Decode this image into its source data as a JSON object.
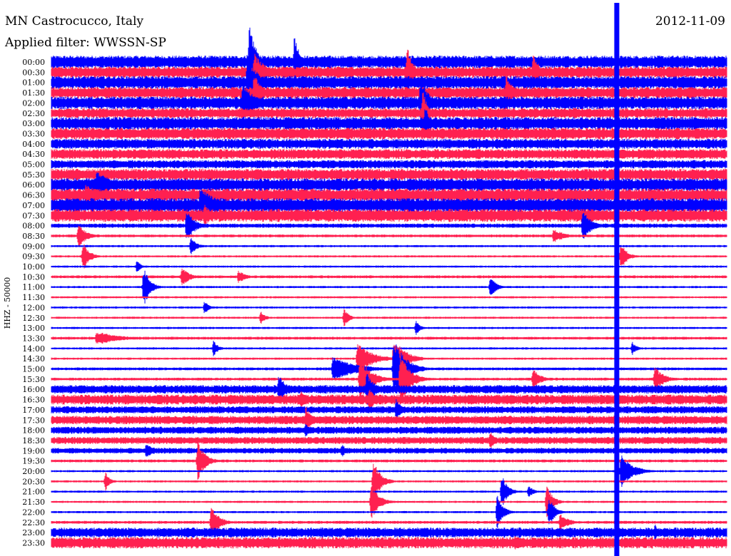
{
  "header": {
    "station": "MN Castrocucco, Italy",
    "filter": "Applied filter: WWSSN-SP",
    "date": "2012-11-09"
  },
  "chart_data": {
    "type": "line",
    "title": "MN Castrocucco, Italy",
    "subtitle": "Applied filter: WWSSN-SP",
    "date": "2012-11-09",
    "ylabel": "HHZ - 50000",
    "colors": {
      "blue": "#0000ff",
      "red": "#ff2050"
    },
    "trace_colors_alternate": [
      "blue",
      "red"
    ],
    "tick_labels": [
      "00:00",
      "00:30",
      "01:00",
      "01:30",
      "02:00",
      "02:30",
      "03:00",
      "03:30",
      "04:00",
      "04:30",
      "05:00",
      "05:30",
      "06:00",
      "06:30",
      "07:00",
      "07:30",
      "08:00",
      "08:30",
      "09:00",
      "09:30",
      "10:00",
      "10:30",
      "11:00",
      "11:30",
      "12:00",
      "12:30",
      "13:00",
      "13:30",
      "14:00",
      "14:30",
      "15:00",
      "15:30",
      "16:00",
      "16:30",
      "17:00",
      "17:30",
      "18:00",
      "18:30",
      "19:00",
      "19:30",
      "20:00",
      "20:30",
      "21:00",
      "21:30",
      "22:00",
      "22:30",
      "23:00",
      "23:30"
    ],
    "x_range_minutes": [
      0,
      30
    ],
    "noise_level": [
      9,
      8,
      9,
      8,
      9,
      7,
      9,
      8,
      7,
      7,
      6,
      8,
      9,
      9,
      10,
      9,
      3,
      2,
      1.5,
      1.5,
      1.5,
      2,
      1.5,
      1.5,
      1.5,
      1.5,
      1.5,
      2,
      1.5,
      1.5,
      2,
      2,
      6,
      7,
      5,
      6,
      5,
      5,
      4,
      2,
      1.5,
      1.5,
      1.5,
      1.5,
      1.5,
      2,
      7,
      8
    ],
    "events": [
      {
        "trace": 0,
        "t": 8.8,
        "amp": 60,
        "len": 0.8
      },
      {
        "trace": 0,
        "t": 10.8,
        "amp": 45,
        "len": 0.6
      },
      {
        "trace": 1,
        "t": 9.0,
        "amp": 28,
        "len": 1.5
      },
      {
        "trace": 1,
        "t": 15.8,
        "amp": 40,
        "len": 0.8
      },
      {
        "trace": 1,
        "t": 21.4,
        "amp": 30,
        "len": 0.8
      },
      {
        "trace": 2,
        "t": 8.7,
        "amp": 45,
        "len": 1.2
      },
      {
        "trace": 3,
        "t": 9.0,
        "amp": 28,
        "len": 1.0
      },
      {
        "trace": 3,
        "t": 20.2,
        "amp": 25,
        "len": 1.0
      },
      {
        "trace": 4,
        "t": 8.5,
        "amp": 30,
        "len": 1.5
      },
      {
        "trace": 4,
        "t": 16.4,
        "amp": 40,
        "len": 1.0
      },
      {
        "trace": 5,
        "t": 16.5,
        "amp": 35,
        "len": 0.6
      },
      {
        "trace": 6,
        "t": 16.6,
        "amp": 28,
        "len": 0.6
      },
      {
        "trace": 12,
        "t": 2.0,
        "amp": 22,
        "len": 2.0
      },
      {
        "trace": 13,
        "t": 1.5,
        "amp": 15,
        "len": 2.5
      },
      {
        "trace": 14,
        "t": 6.6,
        "amp": 25,
        "len": 2.5
      },
      {
        "trace": 15,
        "t": 6.8,
        "amp": 16,
        "len": 1.0
      },
      {
        "trace": 16,
        "t": 6.0,
        "amp": 25,
        "len": 1.0
      },
      {
        "trace": 16,
        "t": 23.6,
        "amp": 25,
        "len": 1.0
      },
      {
        "trace": 17,
        "t": 1.2,
        "amp": 18,
        "len": 1.0
      },
      {
        "trace": 17,
        "t": 22.3,
        "amp": 10,
        "len": 1.5
      },
      {
        "trace": 18,
        "t": 6.2,
        "amp": 12,
        "len": 0.8
      },
      {
        "trace": 19,
        "t": 1.4,
        "amp": 22,
        "len": 0.8
      },
      {
        "trace": 19,
        "t": 25.3,
        "amp": 20,
        "len": 0.8
      },
      {
        "trace": 20,
        "t": 3.8,
        "amp": 10,
        "len": 0.5
      },
      {
        "trace": 21,
        "t": 5.8,
        "amp": 14,
        "len": 1.0
      },
      {
        "trace": 21,
        "t": 8.3,
        "amp": 10,
        "len": 1.0
      },
      {
        "trace": 22,
        "t": 4.1,
        "amp": 30,
        "len": 0.8
      },
      {
        "trace": 22,
        "t": 19.5,
        "amp": 15,
        "len": 0.8
      },
      {
        "trace": 24,
        "t": 6.8,
        "amp": 10,
        "len": 0.6
      },
      {
        "trace": 25,
        "t": 9.3,
        "amp": 10,
        "len": 0.6
      },
      {
        "trace": 25,
        "t": 13.0,
        "amp": 15,
        "len": 0.6
      },
      {
        "trace": 26,
        "t": 16.2,
        "amp": 10,
        "len": 0.6
      },
      {
        "trace": 27,
        "t": 2.0,
        "amp": 10,
        "len": 3.0
      },
      {
        "trace": 28,
        "t": 7.2,
        "amp": 12,
        "len": 0.6
      },
      {
        "trace": 28,
        "t": 25.8,
        "amp": 10,
        "len": 0.6
      },
      {
        "trace": 29,
        "t": 13.6,
        "amp": 22,
        "len": 2.0
      },
      {
        "trace": 29,
        "t": 15.2,
        "amp": 30,
        "len": 1.5
      },
      {
        "trace": 30,
        "t": 12.5,
        "amp": 18,
        "len": 3.0
      },
      {
        "trace": 30,
        "t": 15.2,
        "amp": 45,
        "len": 1.5
      },
      {
        "trace": 31,
        "t": 13.7,
        "amp": 30,
        "len": 1.5
      },
      {
        "trace": 31,
        "t": 15.5,
        "amp": 40,
        "len": 1.2
      },
      {
        "trace": 31,
        "t": 21.4,
        "amp": 15,
        "len": 1.0
      },
      {
        "trace": 31,
        "t": 26.8,
        "amp": 18,
        "len": 1.2
      },
      {
        "trace": 32,
        "t": 10.1,
        "amp": 22,
        "len": 1.0
      },
      {
        "trace": 32,
        "t": 14.0,
        "amp": 25,
        "len": 1.0
      },
      {
        "trace": 33,
        "t": 11.1,
        "amp": 15,
        "len": 0.8
      },
      {
        "trace": 33,
        "t": 14.1,
        "amp": 18,
        "len": 0.8
      },
      {
        "trace": 34,
        "t": 15.3,
        "amp": 16,
        "len": 0.8
      },
      {
        "trace": 35,
        "t": 11.3,
        "amp": 20,
        "len": 0.8
      },
      {
        "trace": 36,
        "t": 11.3,
        "amp": 12,
        "len": 0.6
      },
      {
        "trace": 37,
        "t": 19.5,
        "amp": 14,
        "len": 0.6
      },
      {
        "trace": 38,
        "t": 4.2,
        "amp": 10,
        "len": 1.5
      },
      {
        "trace": 38,
        "t": 12.9,
        "amp": 10,
        "len": 0.6
      },
      {
        "trace": 39,
        "t": 6.5,
        "amp": 28,
        "len": 1.0
      },
      {
        "trace": 40,
        "t": 25.3,
        "amp": 25,
        "len": 1.5
      },
      {
        "trace": 41,
        "t": 2.4,
        "amp": 14,
        "len": 0.6
      },
      {
        "trace": 41,
        "t": 14.3,
        "amp": 30,
        "len": 1.0
      },
      {
        "trace": 42,
        "t": 20.0,
        "amp": 25,
        "len": 0.8
      },
      {
        "trace": 42,
        "t": 21.2,
        "amp": 10,
        "len": 0.6
      },
      {
        "trace": 43,
        "t": 14.2,
        "amp": 28,
        "len": 1.0
      },
      {
        "trace": 43,
        "t": 22.0,
        "amp": 25,
        "len": 0.8
      },
      {
        "trace": 44,
        "t": 19.8,
        "amp": 25,
        "len": 0.8
      },
      {
        "trace": 44,
        "t": 22.1,
        "amp": 22,
        "len": 0.8
      },
      {
        "trace": 45,
        "t": 7.1,
        "amp": 25,
        "len": 1.0
      },
      {
        "trace": 45,
        "t": 22.6,
        "amp": 12,
        "len": 1.2
      },
      {
        "trace": 46,
        "t": 26.8,
        "amp": 14,
        "len": 0.6
      },
      {
        "trace": 47,
        "t": 5.4,
        "amp": 10,
        "len": 0.6
      },
      {
        "trace": 47,
        "t": 20.6,
        "amp": 12,
        "len": 0.6
      }
    ],
    "vertical_artifact_minute": 25.1
  }
}
